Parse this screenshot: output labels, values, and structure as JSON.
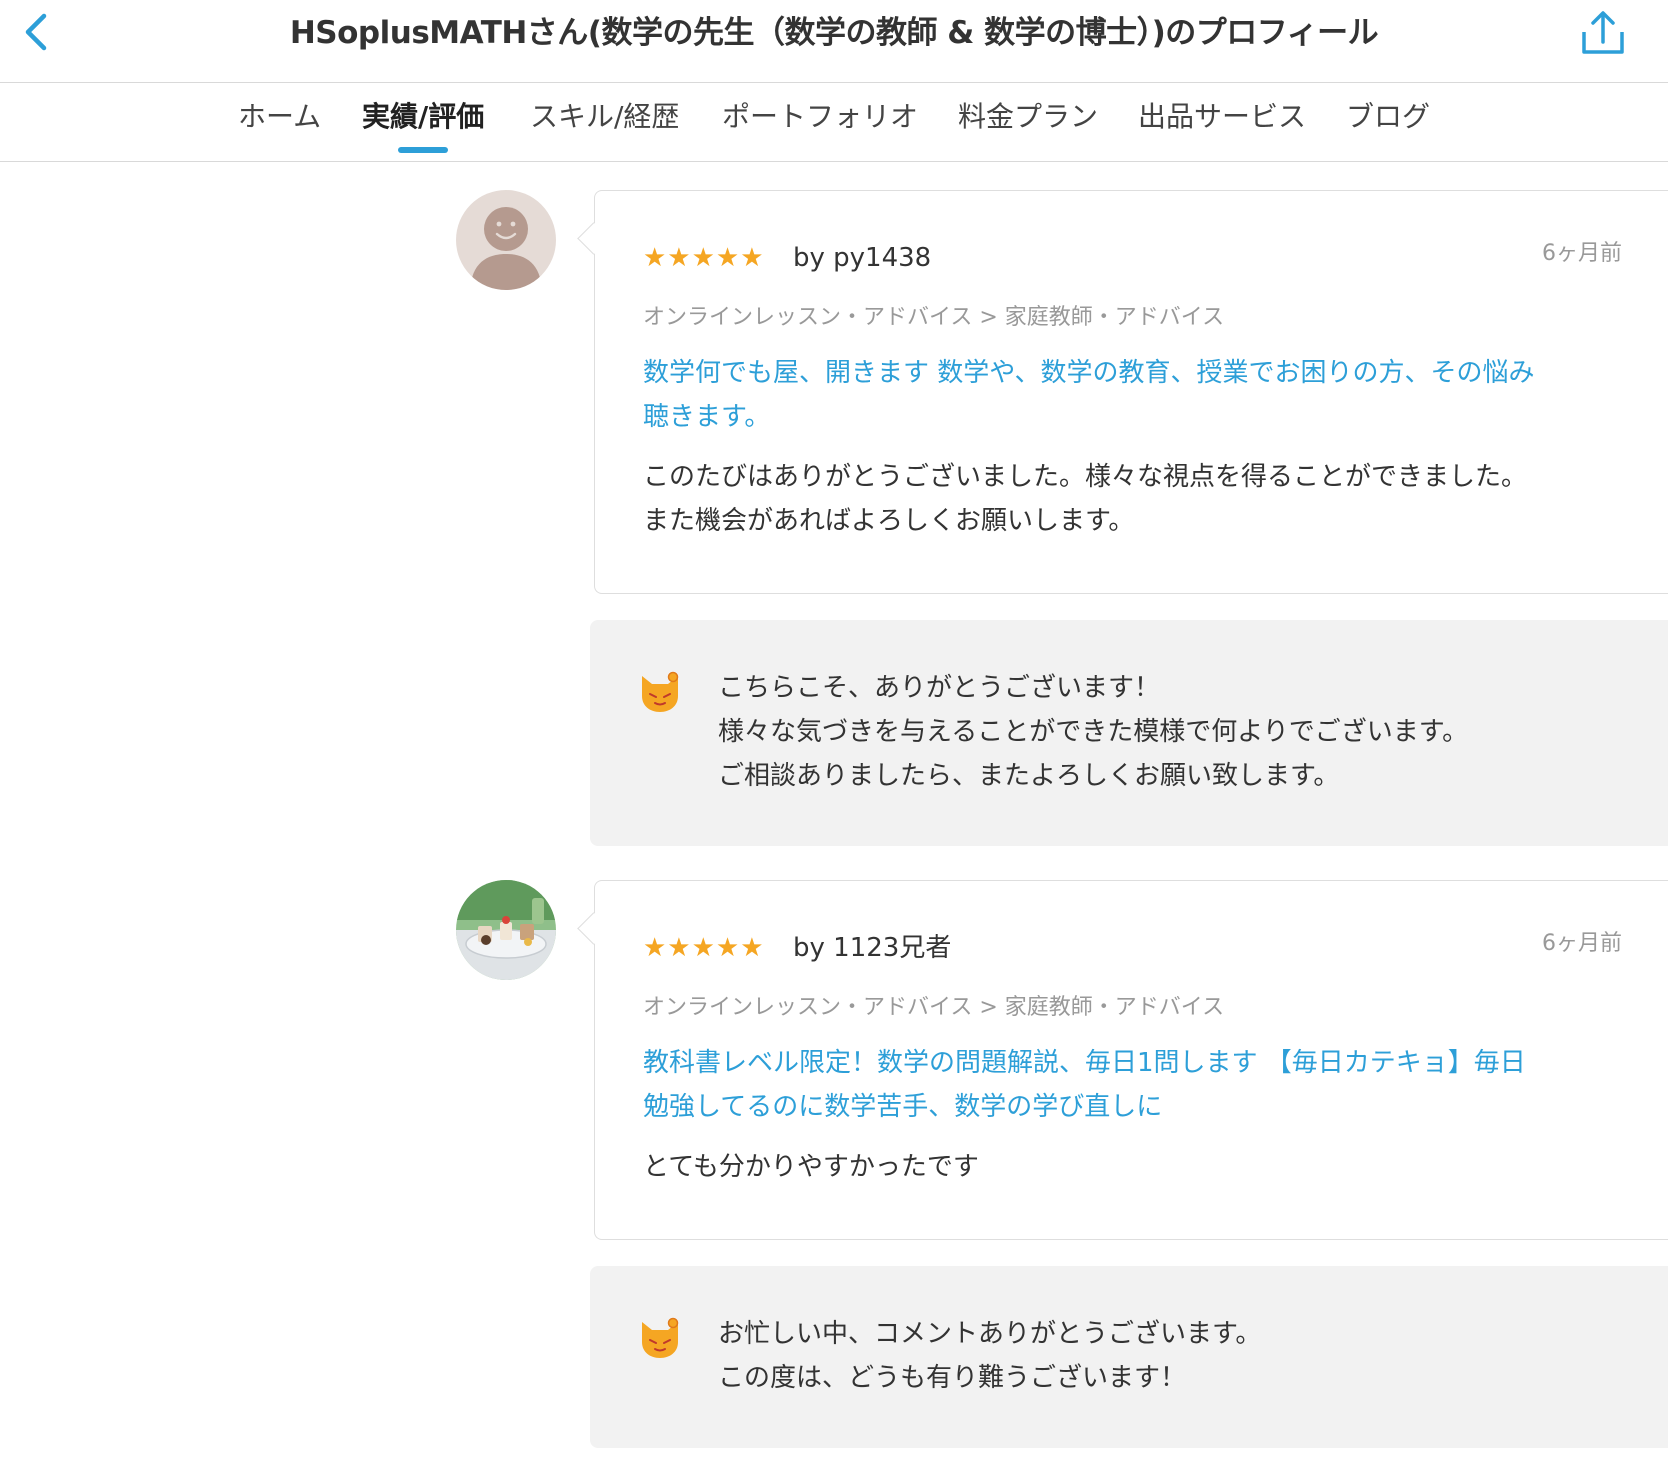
{
  "header": {
    "title": "HSoplusMATHさん(数学の先生（数学の教師 & 数学の博士）)のプロフィール",
    "back_icon": "chevron-left-icon",
    "share_icon": "share-icon",
    "accent_color": "#2d9fd8"
  },
  "tabs": [
    {
      "label": "ホーム",
      "active": false
    },
    {
      "label": "実績/評価",
      "active": true
    },
    {
      "label": "スキル/経歴",
      "active": false
    },
    {
      "label": "ポートフォリオ",
      "active": false
    },
    {
      "label": "料金プラン",
      "active": false
    },
    {
      "label": "出品サービス",
      "active": false
    },
    {
      "label": "ブログ",
      "active": false
    }
  ],
  "reviews": [
    {
      "rating": 5,
      "stars": "★★★★★",
      "by": "by py1438",
      "time_ago": "6ヶ月前",
      "category": "オンラインレッスン・アドバイス > 家庭教師・アドバイス",
      "service_lines": [
        "数学何でも屋、開きます 数学や、数学の教育、授業でお困りの方、その悩み",
        "聴きます。"
      ],
      "body_lines": [
        "このたびはありがとうございました。様々な視点を得ることができました。",
        "また機会があればよろしくお願いします。"
      ],
      "reply_lines": [
        "こちらこそ、ありがとうございます！",
        "様々な気づきを与えることができた模様で何よりでございます。",
        "ご相談ありましたら、またよろしくお願い致します。"
      ]
    },
    {
      "rating": 5,
      "stars": "★★★★★",
      "by": "by 1123兄者",
      "time_ago": "6ヶ月前",
      "category": "オンラインレッスン・アドバイス > 家庭教師・アドバイス",
      "service_lines": [
        "教科書レベル限定！数学の問題解説、毎日1問します 【毎日カテキョ】毎日",
        "勉強してるのに数学苦手、数学の学び直しに"
      ],
      "body_lines": [
        "とても分かりやすかったです"
      ],
      "reply_lines": [
        "お忙しい中、コメントありがとうございます。",
        "この度は、どうも有り難うございます！"
      ]
    }
  ]
}
